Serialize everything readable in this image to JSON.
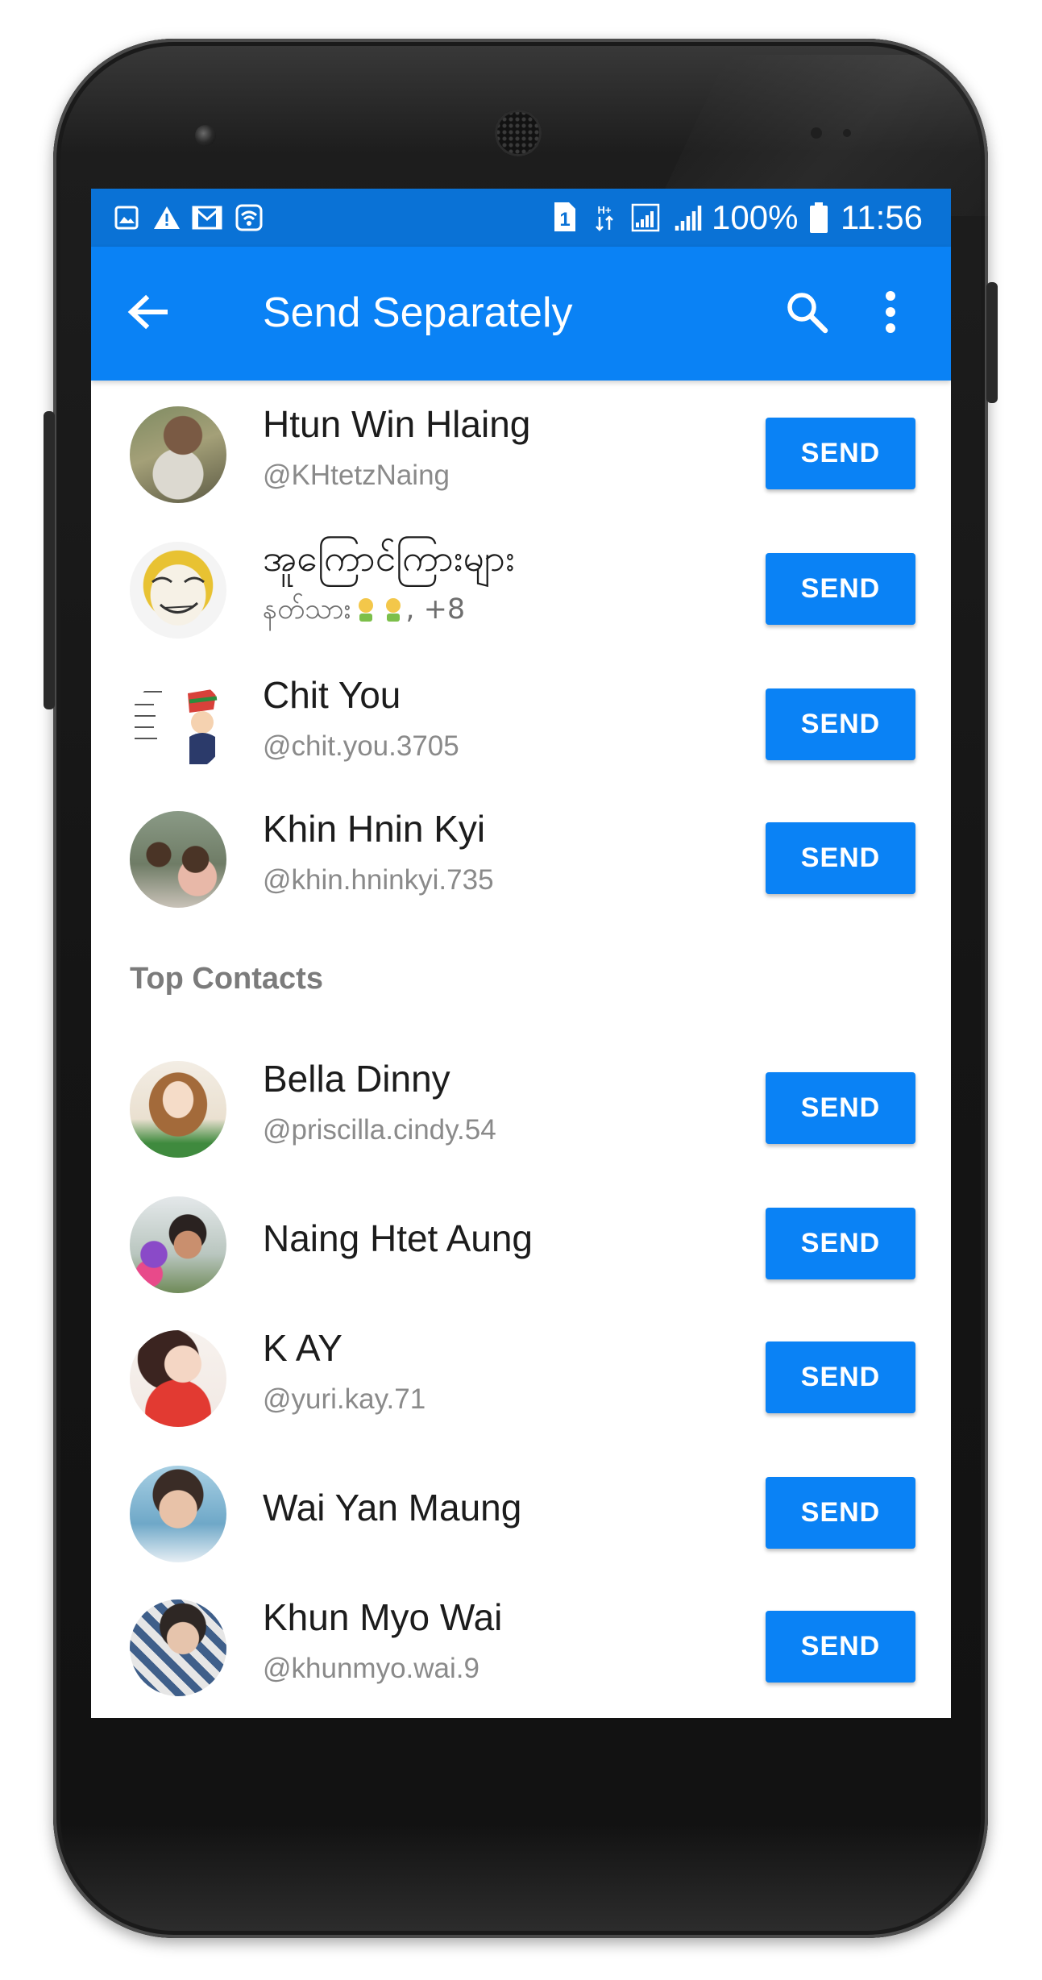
{
  "status_bar": {
    "battery": "100%",
    "time": "11:56",
    "sim_slot": "1",
    "network_type": "H+",
    "icons": [
      "image-notification-icon",
      "warning-icon",
      "gmail-icon",
      "wifi-icon",
      "sim-icon",
      "data-arrows-icon",
      "signal-icon",
      "signal-bars-icon",
      "battery-icon"
    ]
  },
  "app_bar": {
    "title": "Send Separately",
    "back_icon": "arrow-back-icon",
    "search_icon": "search-icon",
    "menu_icon": "more-vert-icon"
  },
  "colors": {
    "status_bar": "#0a72d6",
    "app_bar": "#0a82f5",
    "button": "#0a82f5"
  },
  "contacts_recent": [
    {
      "name": "Htun Win Hlaing",
      "subtitle": "@KHtetzNaing",
      "button": "SEND"
    },
    {
      "name": "အူကြောင်ကြားများ",
      "subtitle": "နတ်သား",
      "subtitle_suffix": ", +8",
      "button": "SEND"
    },
    {
      "name": "Chit You",
      "subtitle": "@chit.you.3705",
      "button": "SEND"
    },
    {
      "name": "Khin Hnin Kyi",
      "subtitle": "@khin.hninkyi.735",
      "button": "SEND"
    }
  ],
  "section_top_contacts": "Top Contacts",
  "contacts_top": [
    {
      "name": "Bella Dinny",
      "subtitle": "@priscilla.cindy.54",
      "button": "SEND"
    },
    {
      "name": "Naing Htet Aung",
      "subtitle": "",
      "button": "SEND"
    },
    {
      "name": "K AY",
      "subtitle": "@yuri.kay.71",
      "button": "SEND"
    },
    {
      "name": "Wai Yan Maung",
      "subtitle": "",
      "button": "SEND"
    },
    {
      "name": "Khun Myo Wai",
      "subtitle": "@khunmyo.wai.9",
      "button": "SEND"
    }
  ]
}
